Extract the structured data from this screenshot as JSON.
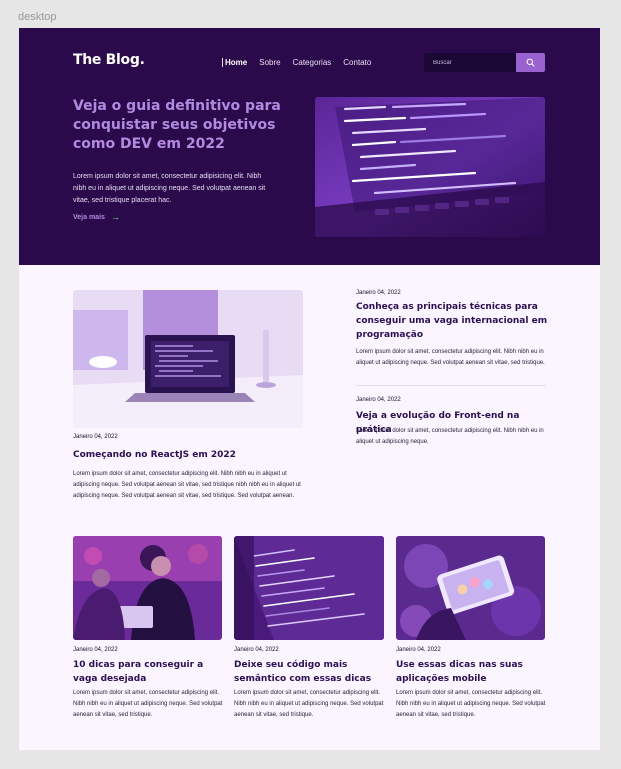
{
  "frame_label": "desktop",
  "header": {
    "logo": "The Blog.",
    "nav": [
      "Home",
      "Sobre",
      "Categorias",
      "Contato"
    ],
    "search_placeholder": "Buscar"
  },
  "hero": {
    "title": "Veja o guia definitivo para conquistar seus objetivos como DEV em 2022",
    "text": "Lorem ipsum dolor sit amet, consectetur adipisicing elit. Nibh nibh eu in aliquet ut adipiscing neque. Sed volutpat aenean sit vitae, sed tristique placerat hac.",
    "link": "Veja mais",
    "arrow": "→"
  },
  "featured": {
    "date": "Janeiro 04, 2022",
    "title": "Começando no ReactJS em 2022",
    "excerpt": "Lorem ipsum dolor sit amet, consectetur adipiscing elit. Nibh nibh eu in aliquet ut adipiscing neque. Sed volutpat aenean sit vitae, sed tristique nibh nibh eu in aliquet ut adipiscing neque. Sed volutpat aenean sit vitae, sed tristique. Sed volutpat aenean."
  },
  "side_posts": [
    {
      "date": "Janeiro 04, 2022",
      "title": "Conheça as principais técnicas para conseguir uma vaga internacional em programação",
      "excerpt": "Lorem ipsum dolor sit amet, consectetur adipiscing elit. Nibh nibh eu in aliquet ut adipiscing neque. Sed volutpat aenean sit vitae, sed tristique."
    },
    {
      "date": "Janeiro 04, 2022",
      "title": "Veja a evolução do Front-end na prática",
      "excerpt": "Lorem ipsum dolor sit amet, consectetur adipiscing elit. Nibh nibh eu in aliquet ut adipiscing neque."
    }
  ],
  "grid_posts": [
    {
      "date": "Janeiro 04, 2022",
      "title": "10 dicas para conseguir a vaga desejada",
      "excerpt": "Lorem ipsum dolor sit amet, consectetur adipiscing elit. Nibh nibh eu in aliquet ut adipiscing neque. Sed volutpat aenean sit vitae, sed tristique."
    },
    {
      "date": "Janeiro 04, 2022",
      "title": "Deixe seu código mais semântico com essas dicas",
      "excerpt": "Lorem ipsum dolor sit amet, consectetur adipiscing elit. Nibh nibh eu in aliquet ut adipiscing neque. Sed volutpat aenean sit vitae, sed tristique."
    },
    {
      "date": "Janeiro 04, 2022",
      "title": "Use essas dicas nas suas aplicações mobile",
      "excerpt": "Lorem ipsum dolor sit amet, consectetur adipiscing elit. Nibh nibh eu in aliquet ut adipiscing neque. Sed volutpat aenean sit vitae, sed tristique."
    }
  ],
  "colors": {
    "hero_bg": "#2b0a4b",
    "accent": "#9a62cf",
    "title": "#2d0f52",
    "page_bg": "#faf5ff"
  },
  "icons": {
    "search": "search-icon",
    "arrow": "arrow-right-icon"
  }
}
